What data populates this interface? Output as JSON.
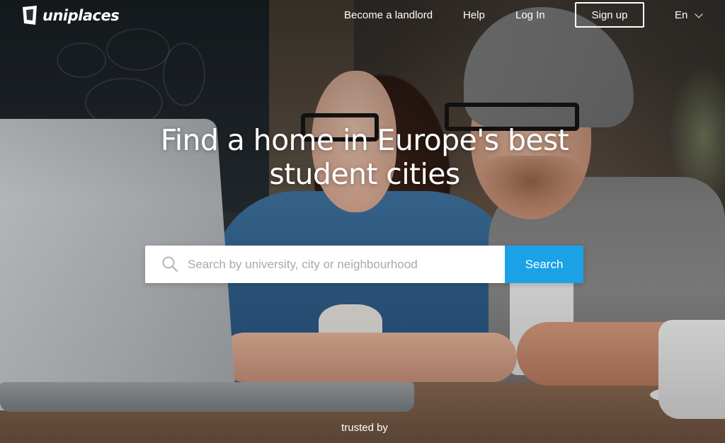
{
  "brand": {
    "name": "uniplaces"
  },
  "nav": {
    "become_landlord": "Become a landlord",
    "help": "Help",
    "login": "Log In",
    "signup": "Sign up",
    "language": "En"
  },
  "hero": {
    "headline_line1": "Find a home in Europe's best",
    "headline_line2": "student cities"
  },
  "search": {
    "placeholder": "Search by university, city or neighbourhood",
    "button": "Search"
  },
  "footer": {
    "trusted_by": "trusted by"
  },
  "colors": {
    "search_button": "#1aa1e6",
    "text": "#ffffff"
  }
}
